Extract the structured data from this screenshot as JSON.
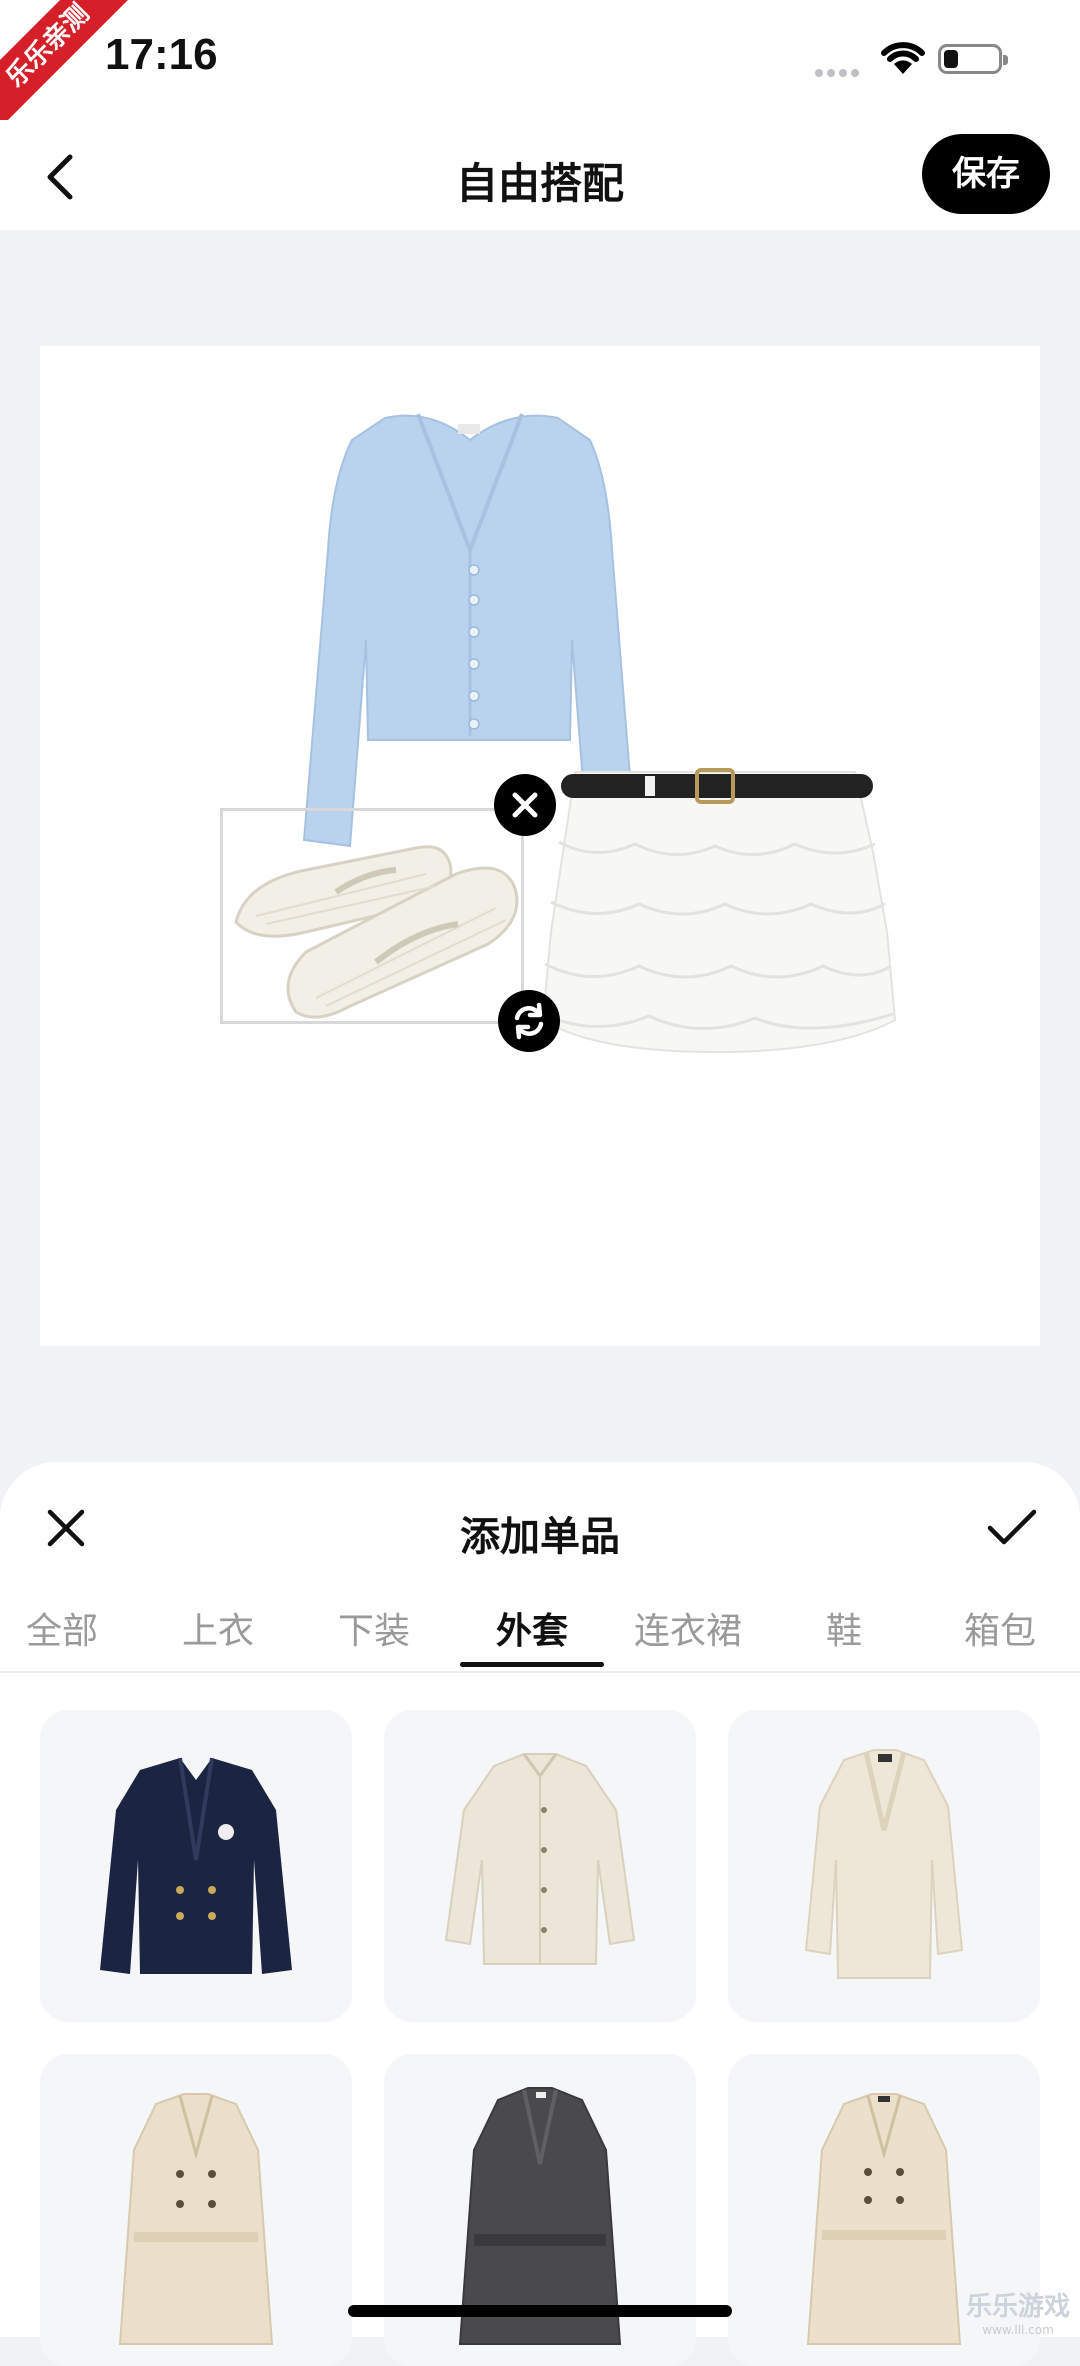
{
  "status_bar": {
    "time": "17:16",
    "ribbon": "乐乐亲测"
  },
  "nav": {
    "title": "自由搭配",
    "save_label": "保存"
  },
  "canvas_items": [
    {
      "name": "light-blue-cardigan"
    },
    {
      "name": "white-tiered-mini-skirt-with-belt"
    },
    {
      "name": "cream-woven-ballet-flats"
    }
  ],
  "sheet": {
    "title": "添加单品",
    "tabs": [
      "全部",
      "上衣",
      "下装",
      "外套",
      "连衣裙",
      "鞋",
      "箱包"
    ],
    "active_tab": "外套"
  },
  "products": [
    {
      "name": "navy-blazer"
    },
    {
      "name": "cream-overshirt-jacket"
    },
    {
      "name": "cream-teddy-coat"
    },
    {
      "name": "beige-trench-coat"
    },
    {
      "name": "grey-belted-coat"
    },
    {
      "name": "beige-belted-trench"
    }
  ],
  "watermark": {
    "text": "乐乐游戏",
    "url": "www.lll.com"
  },
  "colors": {
    "accent": "#000000",
    "background": "#f1f2f6",
    "tab_inactive": "#9a9a9a"
  }
}
